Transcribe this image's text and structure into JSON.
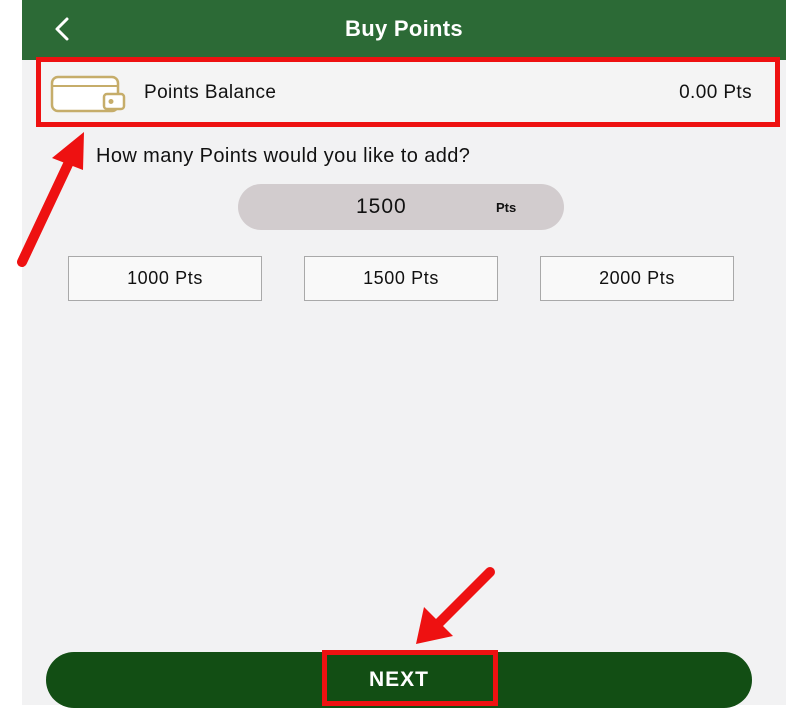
{
  "header": {
    "title": "Buy Points",
    "back_icon": "chevron-left-icon"
  },
  "balance": {
    "icon": "wallet-icon",
    "label": "Points Balance",
    "value": "0.00 Pts"
  },
  "prompt": {
    "question": "How many Points would you like to add?"
  },
  "amount": {
    "value": "1500",
    "unit": "Pts"
  },
  "presets": [
    {
      "label": "1000 Pts"
    },
    {
      "label": "1500 Pts"
    },
    {
      "label": "2000 Pts"
    }
  ],
  "footer": {
    "next_label": "NEXT"
  },
  "colors": {
    "app_bar": "#2c6a36",
    "next_button": "#124e14",
    "annotation": "#ee1111",
    "amount_pill": "#d2ccce"
  }
}
